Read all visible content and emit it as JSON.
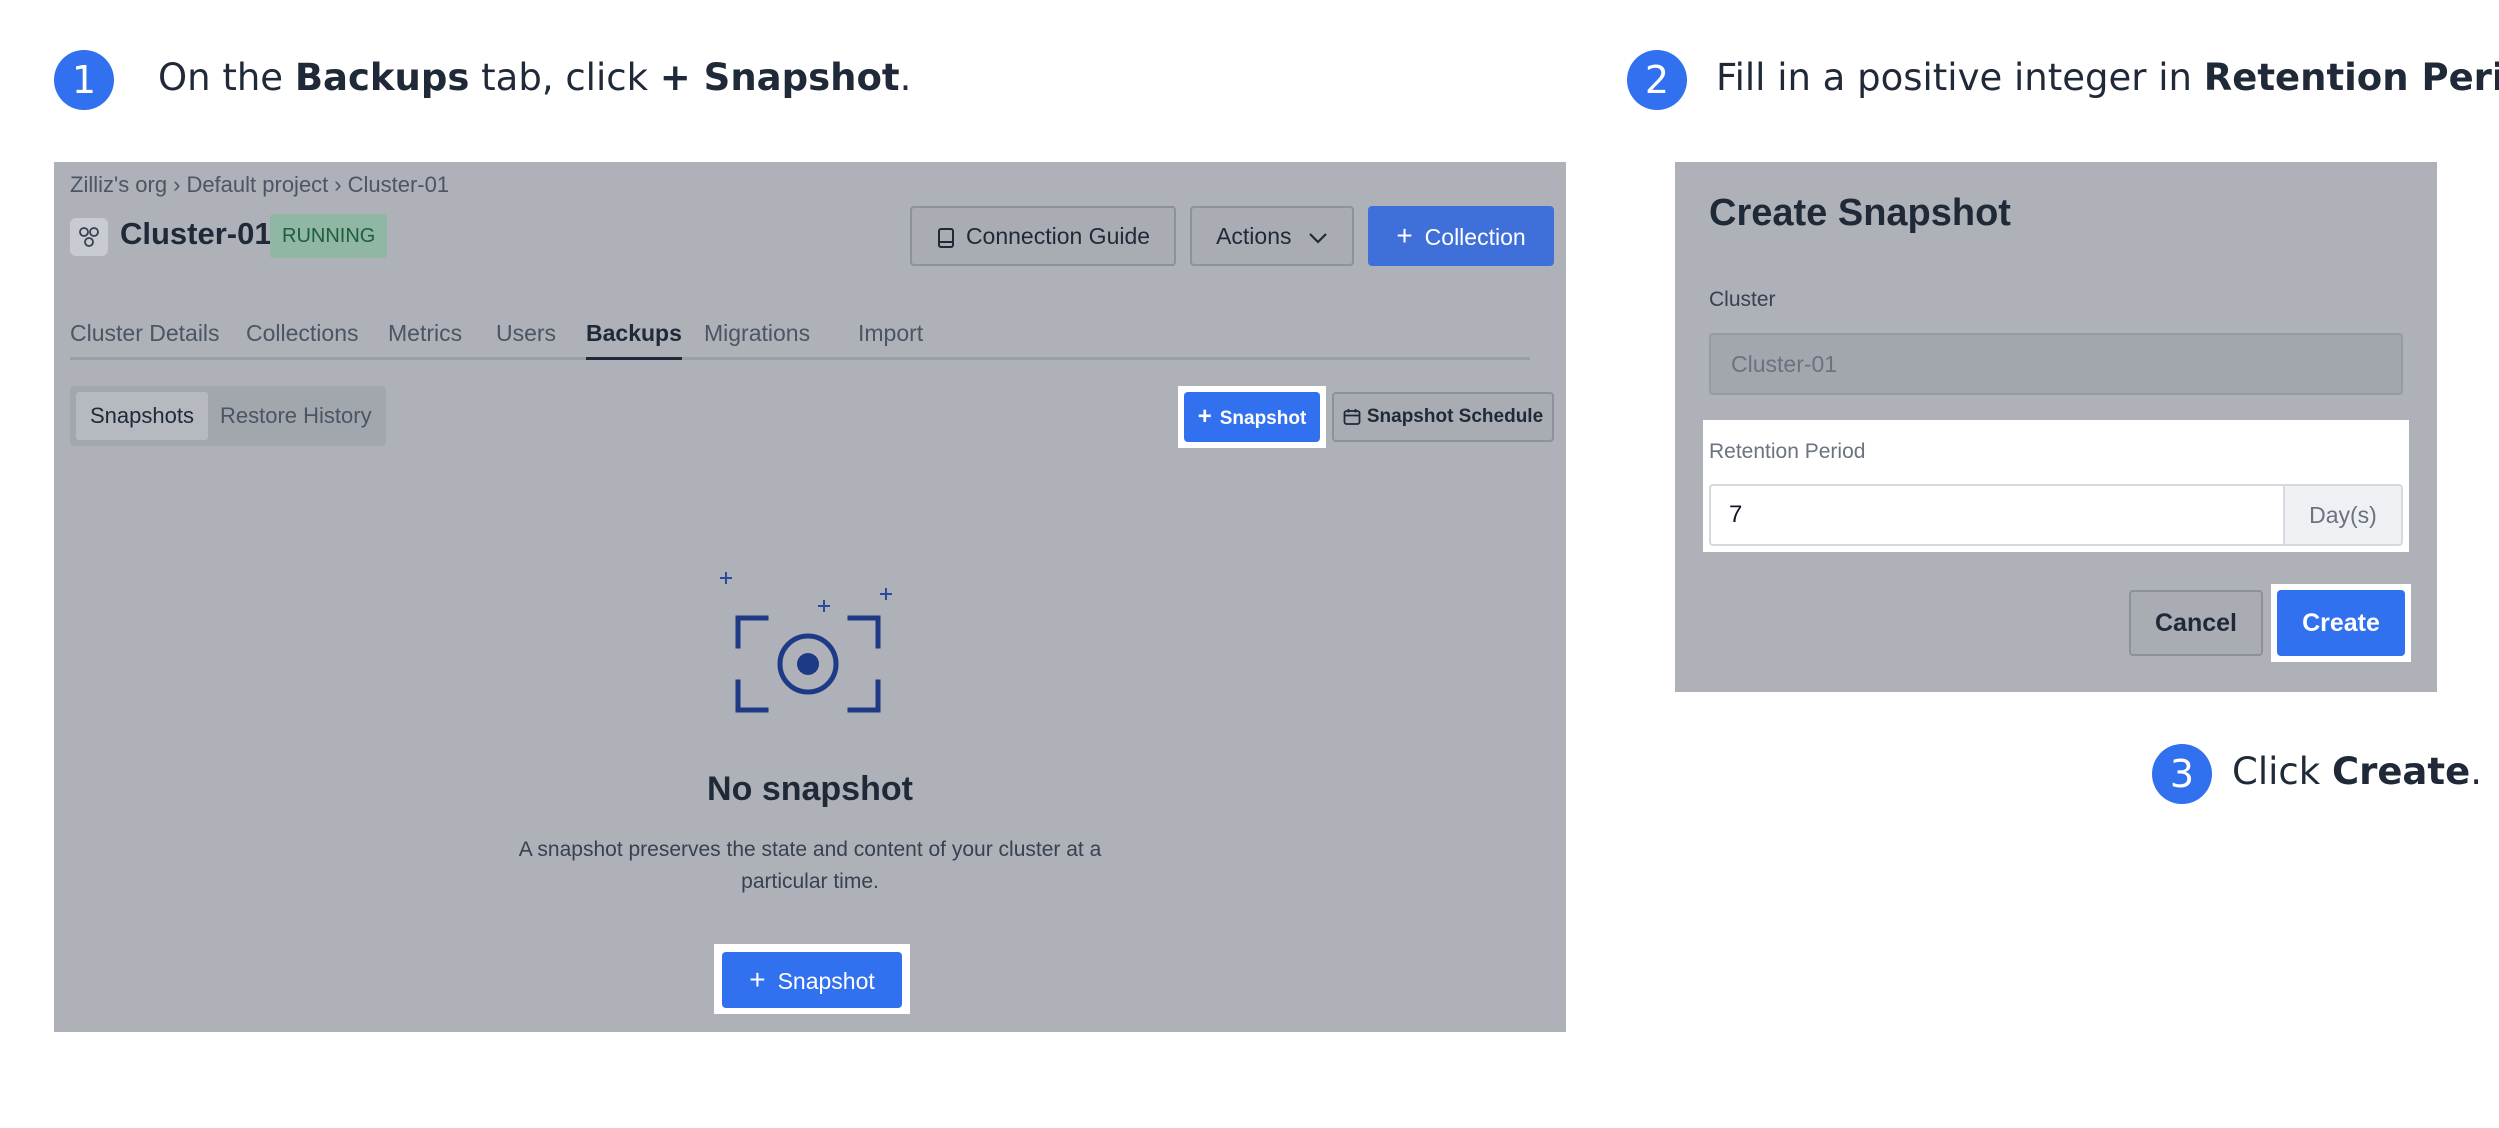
{
  "steps": [
    {
      "num": "1",
      "pre": "On the ",
      "b1": "Backups",
      "mid": " tab, click ",
      "b2": "+ Snapshot",
      "post": "."
    },
    {
      "num": "2",
      "pre": "Fill in a positive integer in ",
      "b1": "Retention Period",
      "post": "."
    },
    {
      "num": "3",
      "pre": "Click ",
      "b1": "Create",
      "post": "."
    }
  ],
  "console": {
    "breadcrumb": [
      "Zilliz's org",
      "Default project",
      "Cluster-01"
    ],
    "cluster_name": "Cluster-01",
    "status": "RUNNING",
    "connection_guide": "Connection Guide",
    "actions": "Actions",
    "add_collection": "Collection",
    "tabs": [
      "Cluster Details",
      "Collections",
      "Metrics",
      "Users",
      "Backups",
      "Migrations",
      "Import"
    ],
    "active_tab": "Backups",
    "subtabs": [
      "Snapshots",
      "Restore History"
    ],
    "snapshot_button": "Snapshot",
    "schedule_button": "Snapshot Schedule",
    "empty_title": "No snapshot",
    "empty_desc": "A snapshot preserves the state and content of your cluster at a particular time.",
    "empty_cta": "Snapshot"
  },
  "dialog": {
    "title": "Create Snapshot",
    "cluster_label": "Cluster",
    "cluster_value": "Cluster-01",
    "retention_label": "Retention Period",
    "retention_value": "7",
    "retention_unit": "Day(s)",
    "cancel": "Cancel",
    "create": "Create"
  },
  "colors": {
    "accent": "#3170ee",
    "overlay": "#aeb1b8"
  }
}
